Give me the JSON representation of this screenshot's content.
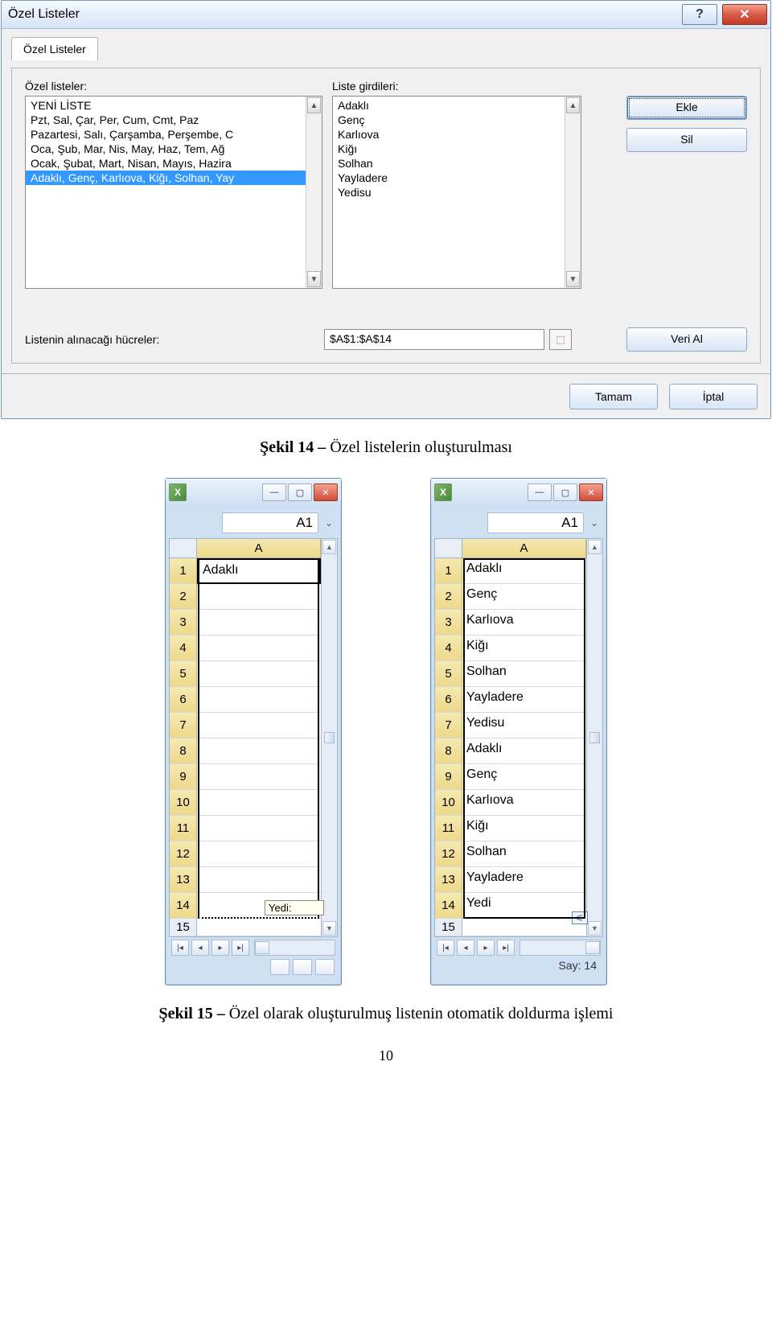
{
  "dialog": {
    "title": "Özel Listeler",
    "tab_label": "Özel Listeler",
    "lists_label": "Özel listeler:",
    "entries_label": "Liste girdileri:",
    "lists": [
      "YENİ LİSTE",
      "Pzt, Sal, Çar, Per, Cum, Cmt, Paz",
      "Pazartesi, Salı, Çarşamba, Perşembe, C",
      "Oca, Şub, Mar, Nis, May, Haz, Tem, Ağ",
      "Ocak, Şubat, Mart, Nisan, Mayıs, Hazira",
      "Adaklı, Genç, Karlıova, Kiğı, Solhan, Yay"
    ],
    "entries": [
      "Adaklı",
      "Genç",
      "Karlıova",
      "Kiğı",
      "Solhan",
      "Yayladere",
      "Yedisu"
    ],
    "btn_add": "Ekle",
    "btn_del": "Sil",
    "cells_label": "Listenin alınacağı hücreler:",
    "range_value": "$A$1:$A$14",
    "btn_import": "Veri Al",
    "btn_ok": "Tamam",
    "btn_cancel": "İptal"
  },
  "caption14_bold": "Şekil 14 – ",
  "caption14_rest": "Özel listelerin oluşturulması",
  "caption15_bold": "Şekil 15 – ",
  "caption15_rest": "Özel olarak oluşturulmuş listenin otomatik doldurma işlemi",
  "excel_left": {
    "namebox": "A1",
    "col": "A",
    "rows": [
      "Adaklı",
      "",
      "",
      "",
      "",
      "",
      "",
      "",
      "",
      "",
      "",
      "",
      "",
      "",
      ""
    ],
    "tooltip": "Yedi:"
  },
  "excel_right": {
    "namebox": "A1",
    "col": "A",
    "rows": [
      "Adaklı",
      "Genç",
      "Karlıova",
      "Kiğı",
      "Solhan",
      "Yayladere",
      "Yedisu",
      "Adaklı",
      "Genç",
      "Karlıova",
      "Kiğı",
      "Solhan",
      "Yayladere",
      "Yedi",
      ""
    ],
    "status": "Say: 14"
  },
  "page_number": "10"
}
